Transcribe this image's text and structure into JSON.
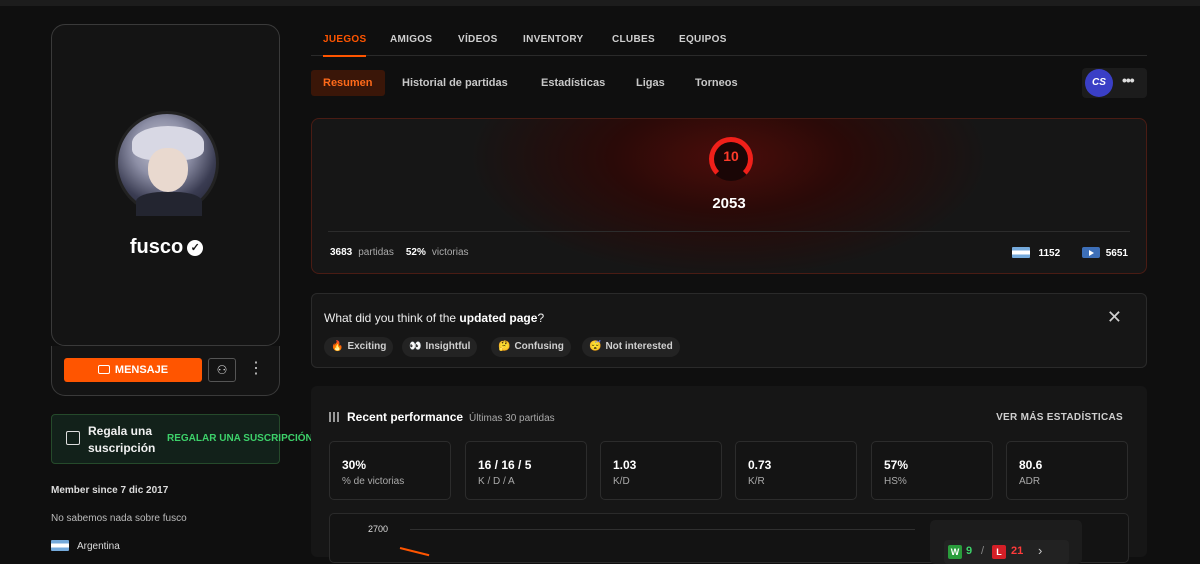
{
  "profile": {
    "username": "fusco",
    "message_label": "MENSAJE",
    "gift_title": "Regala una suscripción",
    "gift_link": "REGALAR UNA SUSCRIPCIÓN",
    "member_since": "Member since 7 dic 2017",
    "about": "No sabemos nada sobre fusco",
    "country": "Argentina"
  },
  "tabs": [
    "JUEGOS",
    "AMIGOS",
    "VÍDEOS",
    "INVENTORY",
    "CLUBES",
    "EQUIPOS"
  ],
  "subtabs": [
    "Resumen",
    "Historial de partidas",
    "Estadísticas",
    "Ligas",
    "Torneos"
  ],
  "game_logo": "CS",
  "hero": {
    "level": "10",
    "elo": "2053",
    "matches_value": "3683",
    "matches_label": "partidas",
    "winrate_value": "52%",
    "winrate_label": "victorias",
    "country_rank": "1152",
    "region_rank": "5651"
  },
  "feedback": {
    "question_prefix": "What did you think of the",
    "question_bold": "updated page",
    "question_suffix": "?",
    "options": [
      {
        "emoji": "🔥",
        "label": "Exciting"
      },
      {
        "emoji": "👀",
        "label": "Insightful"
      },
      {
        "emoji": "🤔",
        "label": "Confusing"
      },
      {
        "emoji": "😴",
        "label": "Not interested"
      }
    ]
  },
  "performance": {
    "title": "Recent performance",
    "subtitle": "Últimas 30 partidas",
    "more_label": "VER MÁS ESTADÍSTICAS",
    "stats": [
      {
        "value": "30%",
        "label": "% de victorias"
      },
      {
        "value": "16 / 16 / 5",
        "label": "K / D / A"
      },
      {
        "value": "1.03",
        "label": "K/D"
      },
      {
        "value": "0.73",
        "label": "K/R"
      },
      {
        "value": "57%",
        "label": "HS%"
      },
      {
        "value": "80.6",
        "label": "ADR"
      }
    ],
    "chart_ytick": "2700",
    "wins_label": "W",
    "wins": "9",
    "losses_label": "L",
    "losses": "21"
  },
  "colors": {
    "accent": "#ff5500",
    "win": "#3dd16a",
    "loss": "#ff3b3b",
    "level_red": "#f0201a"
  }
}
